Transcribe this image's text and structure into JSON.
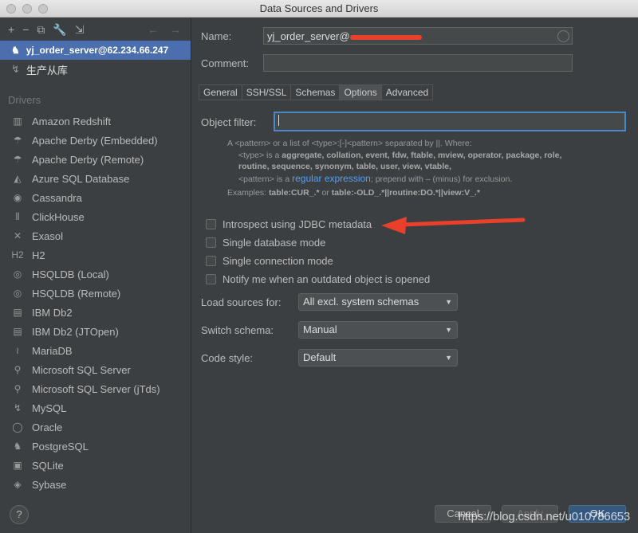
{
  "window": {
    "title": "Data Sources and Drivers"
  },
  "sidebar": {
    "toolbar": {
      "add": "+",
      "remove": "−",
      "copy": "⧉",
      "settings": "🔧",
      "import": "⇲",
      "back": "←",
      "forward": "→"
    },
    "data_sources": [
      {
        "label": "yj_order_server@62.234.66.247",
        "icon": "postgresql-icon",
        "selected": true
      },
      {
        "label": "生产从库",
        "icon": "mysql-icon",
        "selected": false
      }
    ],
    "drivers_header": "Drivers",
    "drivers": [
      {
        "label": "Amazon Redshift",
        "glyph": "▥"
      },
      {
        "label": "Apache Derby (Embedded)",
        "glyph": "☂"
      },
      {
        "label": "Apache Derby (Remote)",
        "glyph": "☂"
      },
      {
        "label": "Azure SQL Database",
        "glyph": "◭"
      },
      {
        "label": "Cassandra",
        "glyph": "◉"
      },
      {
        "label": "ClickHouse",
        "glyph": "⦀"
      },
      {
        "label": "Exasol",
        "glyph": "✕"
      },
      {
        "label": "H2",
        "glyph": "H2"
      },
      {
        "label": "HSQLDB (Local)",
        "glyph": "◎"
      },
      {
        "label": "HSQLDB (Remote)",
        "glyph": "◎"
      },
      {
        "label": "IBM Db2",
        "glyph": "▤"
      },
      {
        "label": "IBM Db2 (JTOpen)",
        "glyph": "▤"
      },
      {
        "label": "MariaDB",
        "glyph": "≀"
      },
      {
        "label": "Microsoft SQL Server",
        "glyph": "⚲"
      },
      {
        "label": "Microsoft SQL Server (jTds)",
        "glyph": "⚲"
      },
      {
        "label": "MySQL",
        "glyph": "↯"
      },
      {
        "label": "Oracle",
        "glyph": "◯"
      },
      {
        "label": "PostgreSQL",
        "glyph": "♞"
      },
      {
        "label": "SQLite",
        "glyph": "▣"
      },
      {
        "label": "Sybase",
        "glyph": "◈"
      }
    ]
  },
  "form": {
    "name_label": "Name:",
    "name_value": "yj_order_server@",
    "comment_label": "Comment:",
    "comment_value": "",
    "tabs": [
      {
        "label": "General"
      },
      {
        "label": "SSH/SSL"
      },
      {
        "label": "Schemas"
      },
      {
        "label": "Options",
        "active": true
      },
      {
        "label": "Advanced"
      }
    ],
    "object_filter_label": "Object filter:",
    "object_filter_value": "",
    "help": {
      "line1": "A <pattern> or a list of <type>:[-]<pattern> separated by ||. Where:",
      "line2_prefix": "<type> is a ",
      "line2_bold": "aggregate, collation, event, fdw, ftable, mview, operator, package, role,",
      "line3_bold": "routine, sequence, synonym, table, user, view, vtable,",
      "line4_prefix": "<pattern> is a ",
      "line4_link": "regular expression",
      "line4_suffix": "; prepend with – (minus) for exclusion.",
      "examples_prefix": "Examples: ",
      "ex1": "table:CUR_.*",
      "or": " or ",
      "ex2": "table:-OLD_.*||routine:DO.*||view:V_.*"
    },
    "checkboxes": [
      {
        "label": "Introspect using JDBC metadata",
        "checked": false
      },
      {
        "label": "Single database mode",
        "checked": false
      },
      {
        "label": "Single connection mode",
        "checked": false
      },
      {
        "label": "Notify me when an outdated object is opened",
        "checked": false
      }
    ],
    "load_sources_label": "Load sources for:",
    "load_sources_value": "All excl. system schemas",
    "switch_schema_label": "Switch schema:",
    "switch_schema_value": "Manual",
    "code_style_label": "Code style:",
    "code_style_value": "Default"
  },
  "buttons": {
    "help": "?",
    "cancel": "Cancel",
    "apply": "Apply",
    "ok": "OK"
  },
  "watermark": "https://blog.csdn.net/u010786653",
  "colors": {
    "selection": "#4b6eaf",
    "annotation_arrow": "#e8402a",
    "link": "#589df6",
    "focus": "#4a88c7"
  }
}
